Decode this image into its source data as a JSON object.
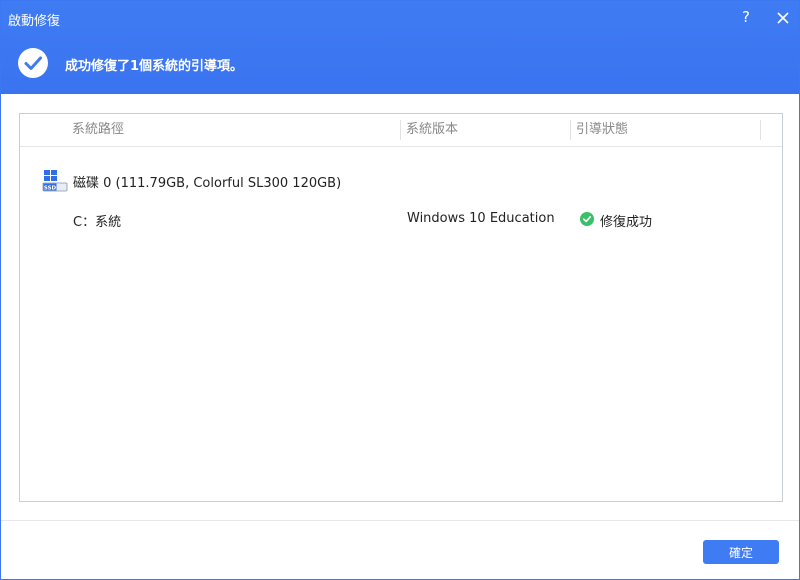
{
  "window": {
    "title": "啟動修復",
    "help_label": "?"
  },
  "banner": {
    "message": "成功修復了1個系統的引導項。",
    "accent_color": "#3f7cf3",
    "success_color": "#3bbf6a"
  },
  "table": {
    "columns": [
      "系統路徑",
      "系統版本",
      "引導狀態"
    ],
    "disk": {
      "icon": "ssd-disk-icon",
      "label": "磁碟 0 (111.79GB, Colorful SL300 120GB)"
    },
    "rows": [
      {
        "path": "C：系統",
        "version": "Windows 10 Education",
        "status": "修復成功",
        "status_icon": "check-circle-icon"
      }
    ]
  },
  "footer": {
    "confirm_label": "確定"
  }
}
